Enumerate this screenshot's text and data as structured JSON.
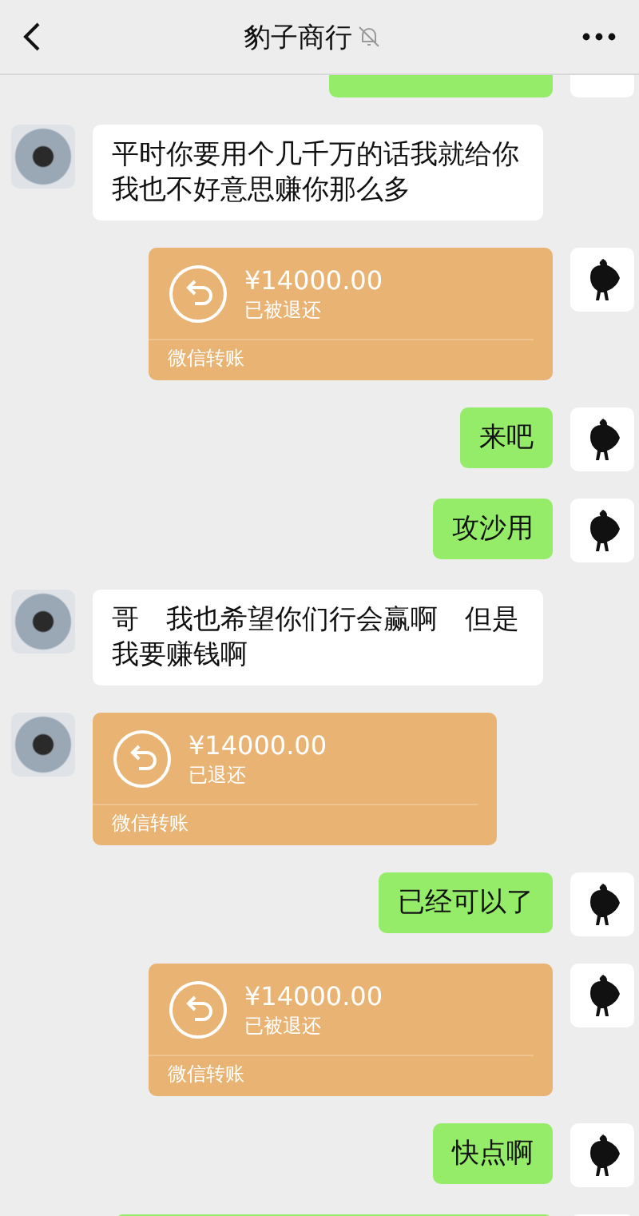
{
  "header": {
    "title": "豹子商行",
    "muted": true
  },
  "messages": [
    {
      "kind": "cut",
      "outgoing": true
    },
    {
      "kind": "text",
      "outgoing": false,
      "text": "平时你要用个几千万的话我就给你我也不好意思赚你那么多"
    },
    {
      "kind": "transfer",
      "outgoing": true,
      "amount": "¥14000.00",
      "status": "已被退还",
      "footer": "微信转账"
    },
    {
      "kind": "text",
      "outgoing": true,
      "text": "来吧"
    },
    {
      "kind": "text",
      "outgoing": true,
      "text": "攻沙用"
    },
    {
      "kind": "text",
      "outgoing": false,
      "text": "哥　我也希望你们行会赢啊　但是我要赚钱啊"
    },
    {
      "kind": "transfer",
      "outgoing": false,
      "amount": "¥14000.00",
      "status": "已退还",
      "footer": "微信转账"
    },
    {
      "kind": "text",
      "outgoing": true,
      "text": "已经可以了"
    },
    {
      "kind": "transfer",
      "outgoing": true,
      "amount": "¥14000.00",
      "status": "已被退还",
      "footer": "微信转账"
    },
    {
      "kind": "text",
      "outgoing": true,
      "text": "快点啊"
    },
    {
      "kind": "cutbottom",
      "outgoing": true
    }
  ]
}
